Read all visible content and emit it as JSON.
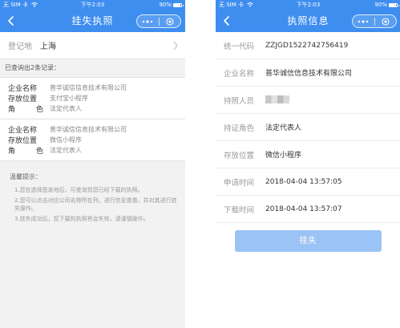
{
  "status_bar": {
    "carrier": "无 SIM 卡",
    "time": "下午2:03",
    "battery": "90%"
  },
  "left": {
    "nav": {
      "title": "挂失执照"
    },
    "region": {
      "label": "登记地",
      "value": "上海"
    },
    "summary": "已查询出2条记录：",
    "records": [
      {
        "company_label": "企业名称",
        "company": "普华诚信信息技术有限公司",
        "location_label": "存放位置",
        "location": "支付宝小程序",
        "role_label_1": "角",
        "role_label_2": "色",
        "role": "法定代表人"
      },
      {
        "company_label": "企业名称",
        "company": "普华诚信信息技术有限公司",
        "location_label": "存放位置",
        "location": "微信小程序",
        "role_label_1": "角",
        "role_label_2": "色",
        "role": "法定代表人"
      }
    ],
    "tips": {
      "title": "温馨提示：",
      "items": [
        "1.您在选择签发地后，可查询到您已经下载的执照。",
        "2.您可以点击对应公司名称所在列，进行信息查看，并对其进行挂失操作。",
        "3.挂失成功后，您下载的执照将会失效，请谨慎操作。"
      ]
    }
  },
  "right": {
    "nav": {
      "title": "执照信息"
    },
    "fields": [
      {
        "label": "统一代码",
        "value": "ZZJGD1522742756419"
      },
      {
        "label": "企业名称",
        "value": "普华诚信信息技术有限公司"
      },
      {
        "label": "持照人员",
        "value": ""
      },
      {
        "label": "持证角色",
        "value": "法定代表人"
      },
      {
        "label": "存放位置",
        "value": "微信小程序"
      },
      {
        "label": "申请时间",
        "value": "2018-04-04 13:57:05"
      },
      {
        "label": "下载时间",
        "value": "2018-04-04 13:57:07"
      }
    ],
    "button": "挂失"
  },
  "colors": {
    "nav": "#3e8ef0",
    "button": "#9cc3f5",
    "page_bg": "#f2f2f2"
  },
  "icons": [
    "back-arrow-icon",
    "more-dots-icon",
    "close-circle-icon",
    "chevron-right-icon",
    "wifi-icon",
    "battery-icon"
  ]
}
